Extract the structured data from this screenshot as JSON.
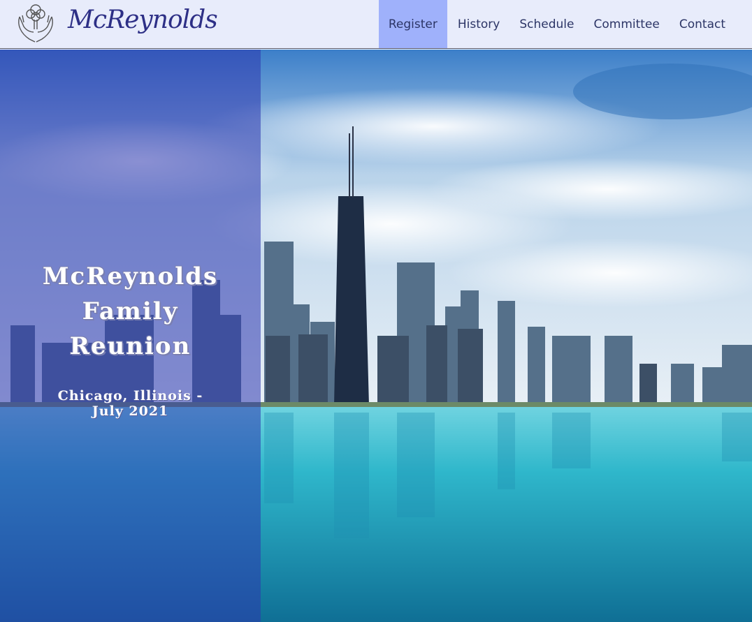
{
  "brand": {
    "name": "McReynolds",
    "logo_icon": "hands-tree-icon"
  },
  "nav": {
    "items": [
      {
        "label": "Register",
        "active": true
      },
      {
        "label": "History",
        "active": false
      },
      {
        "label": "Schedule",
        "active": false
      },
      {
        "label": "Committee",
        "active": false
      },
      {
        "label": "Contact",
        "active": false
      }
    ]
  },
  "hero": {
    "title_lines": [
      "McReynolds",
      "Family",
      "Reunion"
    ],
    "subtitle_lines": [
      "Chicago, Illinois -",
      "July 2021"
    ],
    "background": "chicago-skyline-lake-photo"
  },
  "colors": {
    "header_bg": "#e8ecfb",
    "nav_active_bg": "#9fb1fb",
    "brand_text": "#2d2f86",
    "panel_overlay": "#2e37af",
    "water": "#2ab3c9"
  }
}
